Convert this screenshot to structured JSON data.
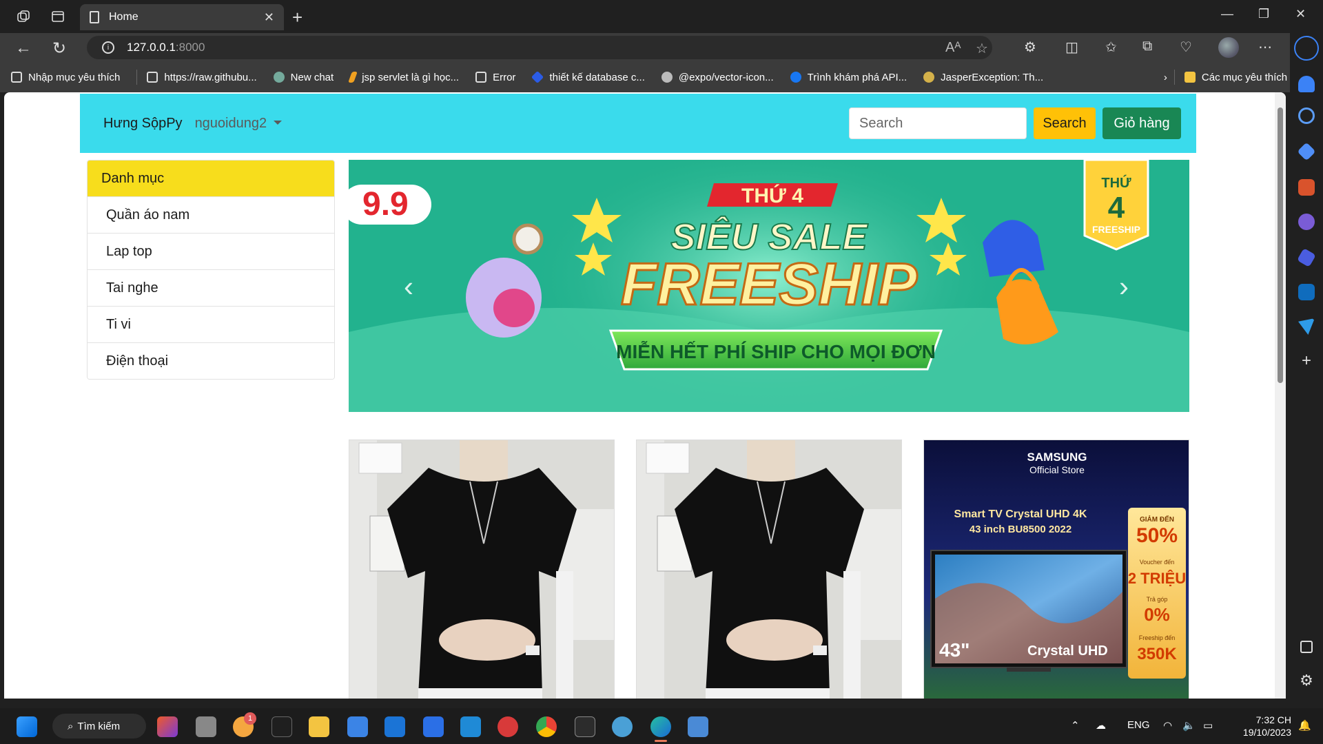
{
  "browser": {
    "tab_title": "Home",
    "url_host": "127.0.0.1",
    "url_port": ":8000",
    "bookmarks": [
      {
        "label": "Nhập mục yêu thích",
        "icon": "import-icon"
      },
      {
        "label": "https://raw.githubu...",
        "icon": "page-icon"
      },
      {
        "label": "New chat",
        "icon": "chatgpt-icon"
      },
      {
        "label": "jsp servlet là gì học...",
        "icon": "bookmark-icon"
      },
      {
        "label": "Error",
        "icon": "page-icon"
      },
      {
        "label": "thiết kế database c...",
        "icon": "bookmark-icon"
      },
      {
        "label": "@expo/vector-icon...",
        "icon": "github-icon"
      },
      {
        "label": "Trình khám phá API...",
        "icon": "facebook-icon"
      },
      {
        "label": "JasperException: Th...",
        "icon": "tomcat-icon"
      }
    ],
    "other_bookmarks": "Các mục yêu thích khác",
    "read_aloud_label": "A⁾"
  },
  "navbar": {
    "brand": "Hưng SộpPy",
    "user": "nguoidung2",
    "search_placeholder": "Search",
    "search_button": "Search",
    "cart_button": "Giỏ hàng"
  },
  "categories": {
    "header": "Danh mục",
    "items": [
      "Quần áo nam",
      "Lap top",
      "Tai nghe",
      "Ti vi",
      "Điện thoại"
    ]
  },
  "banner": {
    "badge_99": "9.9",
    "day_label": "THỨ 4",
    "title_line1": "SIÊU SALE",
    "title_line2": "FREESHIP",
    "ribbon": "MIỄN HẾT PHÍ SHIP CHO MỌI ĐƠN",
    "tag_day": "THỨ",
    "tag_num": "4",
    "tag_text": "FREESHIP"
  },
  "products": {
    "tv": {
      "brand": "SAMSUNG",
      "store": "Official Store",
      "title1": "Smart TV Crystal UHD 4K",
      "title2": "43 inch BU8500 2022",
      "size": "43\"",
      "tv_label": "Crystal UHD",
      "promo": [
        {
          "small": "GIẢM ĐẾN",
          "big": "50%"
        },
        {
          "small": "Voucher đến",
          "big": "2 TRIỆU"
        },
        {
          "small": "Trả góp",
          "big": "0%"
        },
        {
          "small": "Freeship đến",
          "big": "350K"
        }
      ]
    }
  },
  "taskbar": {
    "search_label": "Tìm kiếm",
    "weather_badge": "1",
    "lang": "ENG",
    "time": "7:32 CH",
    "date": "19/10/2023"
  },
  "colors": {
    "navbar_bg": "#3adbec",
    "category_header": "#f7dd1c",
    "search_btn": "#ffc107",
    "cart_btn": "#198754"
  }
}
